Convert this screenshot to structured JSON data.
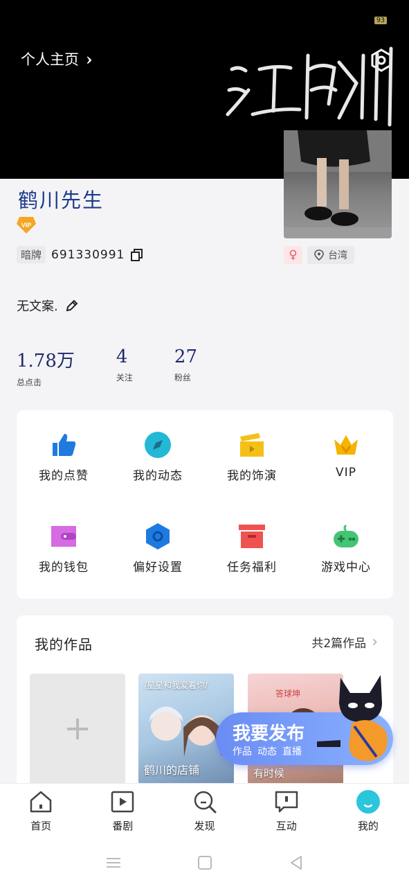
{
  "status": {
    "battery": "93"
  },
  "header": {
    "home_link": "个人主页",
    "calligraphy": "江鹤川"
  },
  "profile": {
    "nickname": "鹤川先生",
    "vip_badge": "VIP",
    "id_tag": "暗牌",
    "id_number": "691330991",
    "gender_symbol": "♀",
    "location": "台湾",
    "bio": "无文案."
  },
  "stats": [
    {
      "value": "1.78万",
      "label": "总点击"
    },
    {
      "value": "4",
      "label": "关注"
    },
    {
      "value": "27",
      "label": "粉丝"
    }
  ],
  "menu": [
    {
      "label": "我的点赞",
      "icon": "thumbs-up-icon",
      "color": "#1f7ae0"
    },
    {
      "label": "我的动态",
      "icon": "compass-icon",
      "color": "#23b8d6"
    },
    {
      "label": "我的饰演",
      "icon": "clapperboard-icon",
      "color": "#f4c016"
    },
    {
      "label": "VIP",
      "icon": "crown-icon",
      "color": "#f4b400"
    },
    {
      "label": "我的钱包",
      "icon": "wallet-icon",
      "color": "#d66be3"
    },
    {
      "label": "偏好设置",
      "icon": "hexagon-settings-icon",
      "color": "#1f7ae0"
    },
    {
      "label": "任务福利",
      "icon": "gift-box-icon",
      "color": "#ef5350"
    },
    {
      "label": "游戏中心",
      "icon": "gamepad-icon",
      "color": "#43c574"
    }
  ],
  "works": {
    "title": "我的作品",
    "count": "共2篇作品",
    "tiles": [
      {
        "caption_top": "/星星和我爱着你/",
        "caption_bottom": "鹤川的店铺"
      },
      {
        "caption_top": "答球坤",
        "caption_bottom": "有时候"
      }
    ]
  },
  "publish": {
    "title": "我要发布",
    "options": [
      "作品",
      "动态",
      "直播"
    ]
  },
  "tabbar": [
    {
      "label": "首页",
      "icon": "home-icon"
    },
    {
      "label": "番剧",
      "icon": "play-icon"
    },
    {
      "label": "发现",
      "icon": "discover-search-icon"
    },
    {
      "label": "互动",
      "icon": "chat-icon"
    },
    {
      "label": "我的",
      "icon": "profile-icon",
      "active": true
    }
  ],
  "colors": {
    "accent": "#2bc5dc",
    "header_bg": "#000000",
    "nickname": "#1e3b8a"
  }
}
